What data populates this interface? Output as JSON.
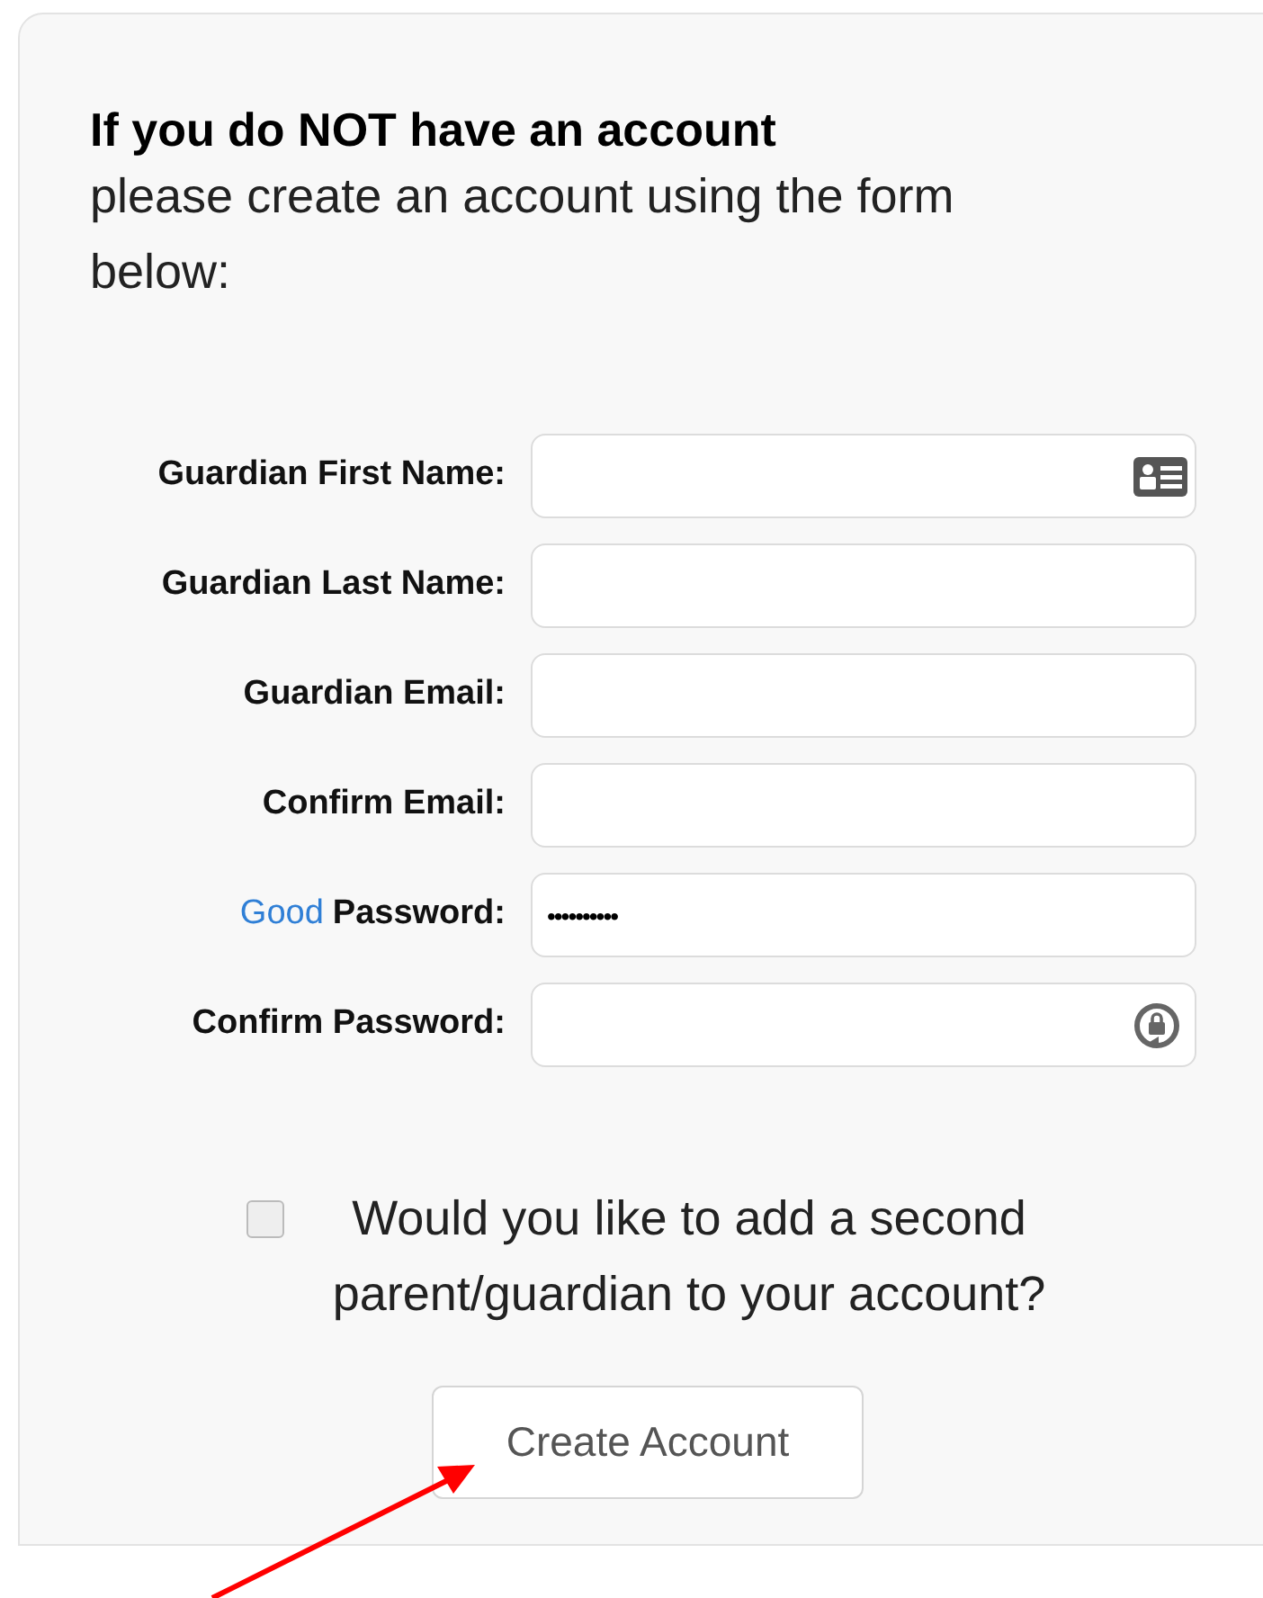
{
  "intro": {
    "heading": "If you do NOT have an account",
    "text": "please create an account using the form below:"
  },
  "fields": [
    {
      "kind": "contact",
      "label": "Guardian First Name:"
    },
    {
      "kind": "plain",
      "label": "Guardian Last Name:"
    },
    {
      "kind": "plain",
      "label": "Guardian Email:"
    },
    {
      "kind": "plain",
      "label": "Confirm Email:"
    },
    {
      "kind": "password",
      "strength": "Good",
      "label": "Password:",
      "value": "••••••••••"
    },
    {
      "kind": "confirm_password",
      "label": "Confirm Password:"
    }
  ],
  "second_guardian": {
    "label": "Would you like to add a second parent/guardian to your account?",
    "checked": false
  },
  "submit": {
    "label": "Create Account"
  }
}
